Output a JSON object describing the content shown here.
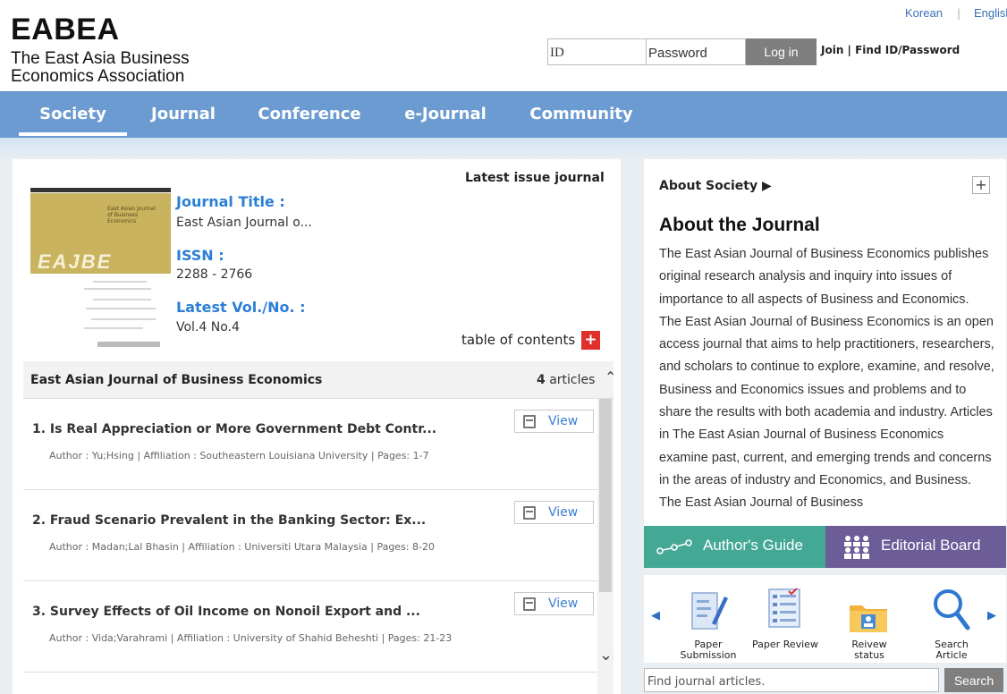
{
  "header": {
    "logo_main": "EABEA",
    "logo_sub": "The East Asia Business Economics Association",
    "lang_korean": "Korean",
    "lang_english": "English",
    "id_placeholder": "ID",
    "pw_placeholder": "Password",
    "login_label": "Log in",
    "join_links": "Join | Find ID/Password"
  },
  "nav": {
    "items": [
      "Society",
      "Journal",
      "Conference",
      "e-Journal",
      "Community"
    ],
    "active": "Society"
  },
  "journal": {
    "latest_label": "Latest issue journal",
    "cover_title": "East Asian Journal of Business Economics",
    "cover_abbrev": "EAJBE",
    "title_label": "Journal Title :",
    "title_value": "East Asian Journal o...",
    "issn_label": "ISSN :",
    "issn_value": "2288 - 2766",
    "vol_label": "Latest Vol./No. :",
    "vol_value": "Vol.4  No.4",
    "toc_label": "table of contents"
  },
  "article_list": {
    "header_title": "East Asian Journal of Business Economics",
    "count": "4",
    "count_suffix": "articles",
    "view_label": "View",
    "items": [
      {
        "title": "1. Is Real Appreciation or More Government Debt Contr...",
        "meta": "Author : Yu;Hsing | Affiliation : Southeastern Louisiana University | Pages: 1-7"
      },
      {
        "title": "2. Fraud Scenario Prevalent in the Banking Sector: Ex...",
        "meta": "Author : Madan;Lal Bhasin | Affiliation : Universiti Utara Malaysia | Pages: 8-20"
      },
      {
        "title": "3. Survey Effects of Oil Income on Nonoil Export and ...",
        "meta": "Author : Vida;Varahrami | Affiliation : University of Shahid Beheshti | Pages: 21-23"
      }
    ]
  },
  "about": {
    "society_label": "About Society ▶",
    "plus": "+",
    "journal_heading": "About the Journal",
    "text": "The East Asian Journal of Business Economics publishes original research analysis and inquiry into issues of importance to all aspects of Business and Economics. The East Asian Journal of Business Economics is an open access journal that aims to help practitioners, researchers, and scholars to continue to explore, examine, and resolve, Business and Economics issues and problems and to share the results with both academia and industry. Articles in The East Asian Journal of Business Economics examine past, current, and emerging trends and concerns in the areas of industry and Economics, and Business. The East Asian Journal of Business"
  },
  "quick_buttons": {
    "authors_guide": "Author's Guide",
    "editorial_board": "Editorial Board"
  },
  "quick_links": [
    {
      "line1": "Paper",
      "line2": "Submission",
      "icon": "document-pen-icon"
    },
    {
      "line1": "",
      "line2": "Paper Review",
      "icon": "checklist-icon"
    },
    {
      "line1": "Reivew",
      "line2": "status",
      "icon": "folder-user-icon"
    },
    {
      "line1": "Search",
      "line2": "Article",
      "icon": "magnifier-icon"
    }
  ],
  "search": {
    "placeholder": "Find journal articles.",
    "button": "Search"
  },
  "colors": {
    "nav": "#6b9bd1",
    "link_blue": "#2c7fd6",
    "guide_green": "#43a894",
    "board_purple": "#6c5d99",
    "toc_red": "#e0302c",
    "button_gray": "#7f7f7f"
  }
}
